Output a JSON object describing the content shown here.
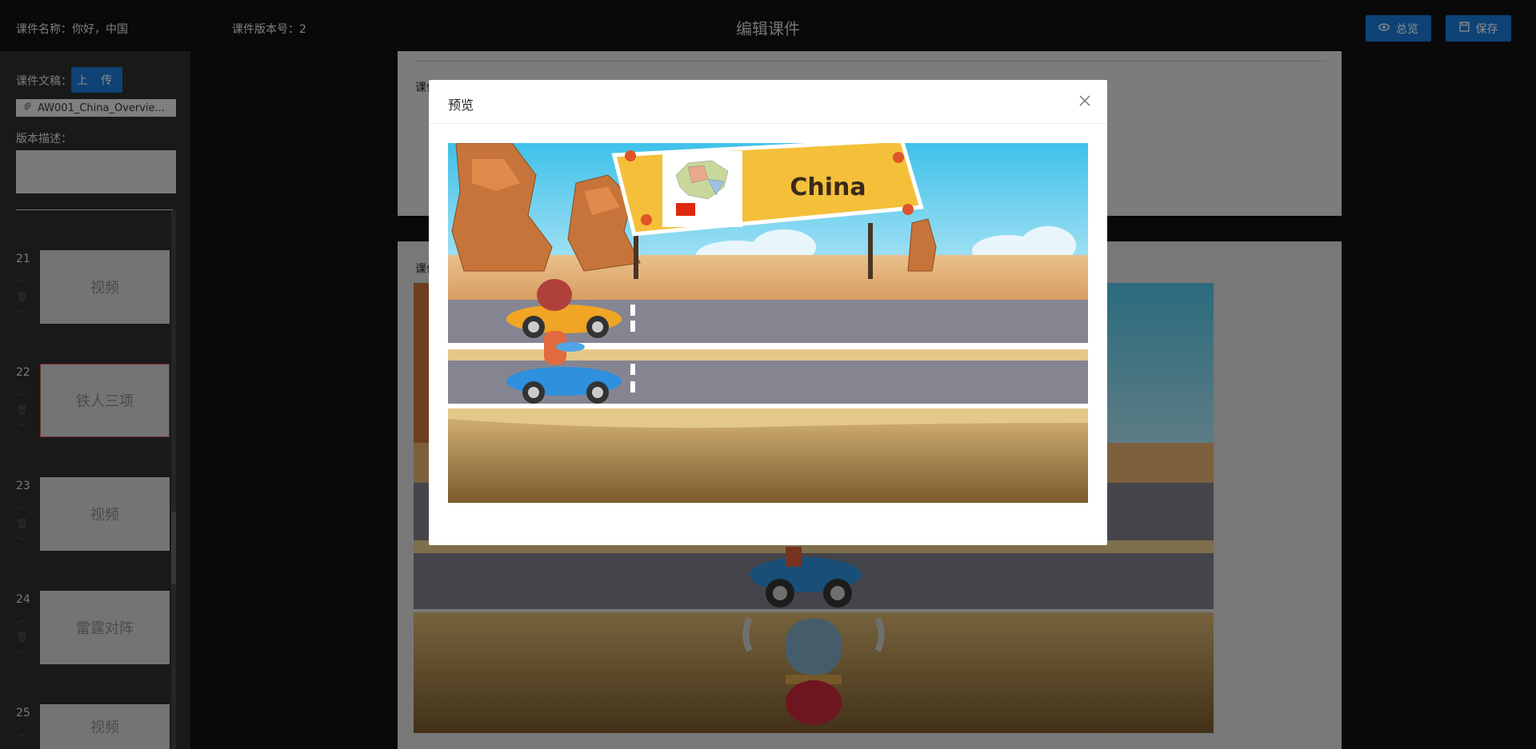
{
  "header": {
    "course_name_label": "课件名称：你好，中国",
    "version_label": "课件版本号：2",
    "title": "编辑课件",
    "preview_button": "总览",
    "save_button": "保存"
  },
  "sidebar": {
    "doc_label": "课件文稿：",
    "upload_button": "上 传",
    "file_name": "AW001_China_Overvie...",
    "version_desc_label": "版本描述：",
    "slides": [
      {
        "number": "21",
        "title": "视频",
        "active": false
      },
      {
        "number": "22",
        "title": "铁人三项",
        "active": true
      },
      {
        "number": "23",
        "title": "视频",
        "active": false
      },
      {
        "number": "24",
        "title": "雷霆对阵",
        "active": false
      },
      {
        "number": "25",
        "title": "视频",
        "active": false
      }
    ]
  },
  "main": {
    "panel1_label": "课件",
    "panel2_label": "课件"
  },
  "modal": {
    "title": "预览",
    "sign_text": "China"
  },
  "colors": {
    "accent": "#1a78d6",
    "active_border": "#d9534f"
  }
}
